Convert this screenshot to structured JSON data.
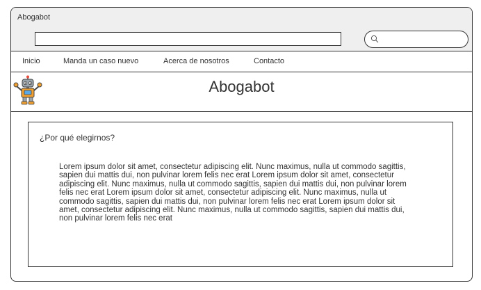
{
  "window": {
    "title": "Abogabot"
  },
  "addressbar": {
    "url_value": "",
    "search_value": "",
    "search_icon": "search-icon"
  },
  "nav": {
    "items": [
      {
        "label": "Inicio"
      },
      {
        "label": "Manda un caso nuevo"
      },
      {
        "label": "Acerca de nosotros"
      },
      {
        "label": "Contacto"
      }
    ]
  },
  "header": {
    "logo_icon": "robot-icon",
    "title": "Abogabot"
  },
  "content": {
    "heading": "¿Por qué  elegirnos?",
    "body": "Lorem ipsum dolor sit amet, consectetur adipiscing elit. Nunc maximus, nulla ut commodo sagittis, sapien dui mattis dui, non pulvinar lorem felis nec erat Lorem ipsum dolor sit amet, consectetur adipiscing elit. Nunc maximus, nulla ut commodo sagittis, sapien dui mattis dui, non pulvinar lorem felis nec erat Lorem ipsum dolor sit amet, consectetur adipiscing elit. Nunc maximus, nulla ut commodo sagittis, sapien dui mattis dui, non pulvinar lorem felis nec erat Lorem ipsum dolor sit amet, consectetur adipiscing elit. Nunc maximus, nulla ut commodo sagittis, sapien dui mattis dui, non pulvinar lorem felis nec erat"
  },
  "colors": {
    "chrome_bg": "#efefef",
    "border": "#333333",
    "text": "#333333"
  }
}
